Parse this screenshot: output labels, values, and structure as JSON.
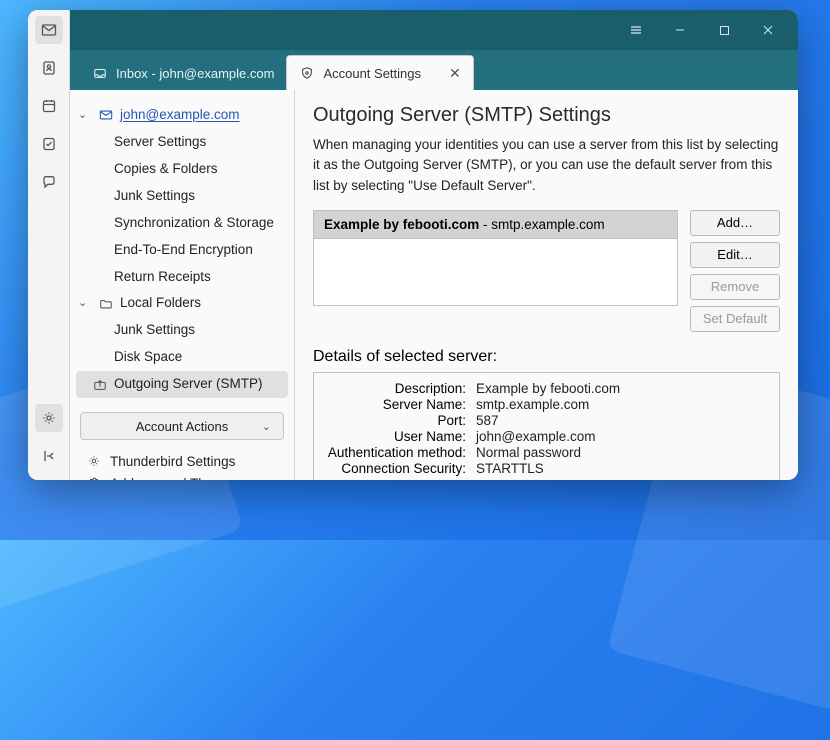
{
  "tabs": {
    "inbox": "Inbox - john@example.com",
    "settings": "Account Settings"
  },
  "tree": {
    "account": "john@example.com",
    "items": [
      "Server Settings",
      "Copies & Folders",
      "Junk Settings",
      "Synchronization & Storage",
      "End-To-End Encryption",
      "Return Receipts"
    ],
    "local": "Local Folders",
    "local_items": [
      "Junk Settings",
      "Disk Space"
    ],
    "smtp": "Outgoing Server (SMTP)",
    "account_actions": "Account Actions",
    "tb_settings": "Thunderbird Settings",
    "addons": "Add-ons and Themes"
  },
  "content": {
    "title": "Outgoing Server (SMTP) Settings",
    "desc": "When managing your identities you can use a server from this list by selecting it as the Outgoing Server (SMTP), or you can use the default server from this list by selecting \"Use Default Server\".",
    "server_name": "Example by febooti.com",
    "server_sep": " - ",
    "server_host": "smtp.example.com",
    "buttons": {
      "add": "Add…",
      "edit": "Edit…",
      "remove": "Remove",
      "setdefault": "Set Default"
    },
    "details_heading": "Details of selected server:",
    "details": {
      "k1": "Description:",
      "v1": "Example by febooti.com",
      "k2": "Server Name:",
      "v2": "smtp.example.com",
      "k3": "Port:",
      "v3": "587",
      "k4": "User Name:",
      "v4": "john@example.com",
      "k5": "Authentication method:",
      "v5": "Normal password",
      "k6": "Connection Security:",
      "v6": "STARTTLS"
    }
  }
}
